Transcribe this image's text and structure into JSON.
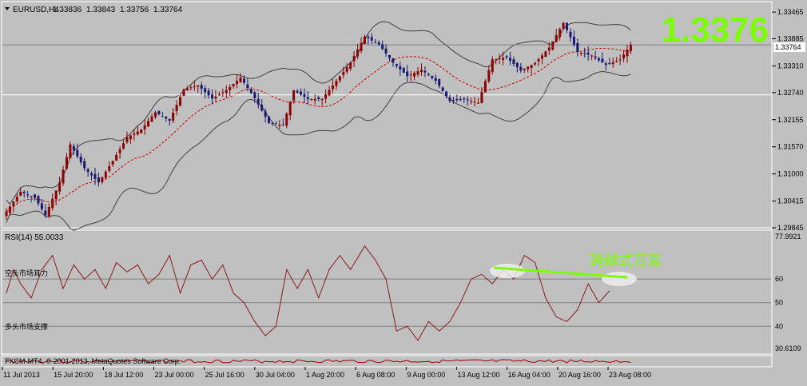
{
  "header": {
    "title": "EURUSD,H4",
    "ohlc": [
      "1.33836",
      "1.33843",
      "1.33756",
      "1.33764"
    ]
  },
  "big_price": "1.3376",
  "current_price_tag": "1.33764",
  "rsi_title": "RSI(14) 55.0033",
  "annotations": {
    "divergence": "跨越式背离",
    "short_zone": "空头市场耳力",
    "long_zone": "多头市场支撑"
  },
  "copyright": "FXCM-MT4, © 2001-2013, MetaQuotes Software Corp.",
  "colors": {
    "background": "#c0c0c0",
    "bull_candle": "#8b0000",
    "bear_candle": "#191970",
    "rsi_line": "#8b1a1a",
    "ma_line": "#d00000",
    "bands": "#404040",
    "big_price": "#7cfc00",
    "divergence": "#7cfc00"
  },
  "chart_data": [
    {
      "type": "candlestick",
      "title": "EURUSD,H4",
      "ylim": [
        1.2985,
        1.3465
      ],
      "ticks": [
        {
          "value": 1.3446,
          "label": "1.33465"
        },
        {
          "value": 1.3389,
          "label": "1.33885"
        },
        {
          "value": 1.3331,
          "label": "1.33310"
        },
        {
          "value": 1.3274,
          "label": "1.32740"
        },
        {
          "value": 1.3216,
          "label": "1.32155"
        },
        {
          "value": 1.3158,
          "label": "1.31570"
        },
        {
          "value": 1.31,
          "label": "1.31000"
        },
        {
          "value": 1.3042,
          "label": "1.30415"
        },
        {
          "value": 1.2985,
          "label": "1.29845"
        }
      ],
      "horizontal_lines": [
        1.3376,
        1.3269
      ],
      "overlays": [
        "Bollinger Bands",
        "Moving Average"
      ],
      "close_anchors": [
        [
          0,
          1.302
        ],
        [
          4,
          1.3062
        ],
        [
          8,
          1.3049
        ],
        [
          11,
          1.3012
        ],
        [
          15,
          1.3082
        ],
        [
          18,
          1.3163
        ],
        [
          22,
          1.3112
        ],
        [
          26,
          1.3082
        ],
        [
          30,
          1.3128
        ],
        [
          34,
          1.3178
        ],
        [
          38,
          1.3195
        ],
        [
          42,
          1.3232
        ],
        [
          46,
          1.3214
        ],
        [
          50,
          1.3281
        ],
        [
          54,
          1.3289
        ],
        [
          58,
          1.3261
        ],
        [
          62,
          1.3279
        ],
        [
          66,
          1.3306
        ],
        [
          70,
          1.3262
        ],
        [
          74,
          1.3209
        ],
        [
          78,
          1.3204
        ],
        [
          81,
          1.3279
        ],
        [
          85,
          1.326
        ],
        [
          89,
          1.326
        ],
        [
          93,
          1.3299
        ],
        [
          97,
          1.3338
        ],
        [
          101,
          1.3394
        ],
        [
          105,
          1.3377
        ],
        [
          109,
          1.3338
        ],
        [
          113,
          1.3309
        ],
        [
          117,
          1.3323
        ],
        [
          121,
          1.3299
        ],
        [
          125,
          1.3256
        ],
        [
          129,
          1.326
        ],
        [
          133,
          1.3252
        ],
        [
          137,
          1.3345
        ],
        [
          141,
          1.3349
        ],
        [
          145,
          1.3321
        ],
        [
          149,
          1.3337
        ],
        [
          153,
          1.337
        ],
        [
          157,
          1.3423
        ],
        [
          161,
          1.3361
        ],
        [
          165,
          1.3353
        ],
        [
          169,
          1.3333
        ],
        [
          173,
          1.3345
        ],
        [
          176,
          1.3376
        ]
      ]
    },
    {
      "type": "line",
      "title": "RSI(14) 55.0033",
      "ylim": [
        30.6109,
        77.9921
      ],
      "ticks": [
        {
          "value": 77.9921,
          "label": "77.9921"
        },
        {
          "value": 60,
          "label": "60"
        },
        {
          "value": 50,
          "label": "50"
        },
        {
          "value": 40,
          "label": "40"
        },
        {
          "value": 30.6109,
          "label": "30.6109"
        }
      ],
      "levels": [
        60,
        50,
        40
      ],
      "series": [
        {
          "anchors": [
            [
              0,
              54
            ],
            [
              2,
              64
            ],
            [
              4,
              58
            ],
            [
              7,
              52
            ],
            [
              10,
              64
            ],
            [
              13,
              70
            ],
            [
              16,
              56
            ],
            [
              19,
              66
            ],
            [
              22,
              60
            ],
            [
              25,
              64
            ],
            [
              28,
              56
            ],
            [
              31,
              67
            ],
            [
              34,
              63
            ],
            [
              37,
              66
            ],
            [
              40,
              58
            ],
            [
              43,
              62
            ],
            [
              46,
              70
            ],
            [
              49,
              54
            ],
            [
              52,
              66
            ],
            [
              55,
              68
            ],
            [
              58,
              60
            ],
            [
              61,
              66
            ],
            [
              64,
              54
            ],
            [
              67,
              50
            ],
            [
              70,
              42
            ],
            [
              73,
              36
            ],
            [
              76,
              40
            ],
            [
              79,
              64
            ],
            [
              82,
              56
            ],
            [
              85,
              64
            ],
            [
              88,
              52
            ],
            [
              91,
              64
            ],
            [
              94,
              70
            ],
            [
              97,
              64
            ],
            [
              101,
              74
            ],
            [
              104,
              68
            ],
            [
              107,
              60
            ],
            [
              110,
              38
            ],
            [
              113,
              40
            ],
            [
              116,
              34
            ],
            [
              119,
              42
            ],
            [
              122,
              38
            ],
            [
              125,
              42
            ],
            [
              128,
              50
            ],
            [
              131,
              60
            ],
            [
              134,
              62
            ],
            [
              137,
              58
            ],
            [
              140,
              64
            ],
            [
              143,
              60
            ],
            [
              146,
              70
            ],
            [
              149,
              67
            ],
            [
              152,
              52
            ],
            [
              155,
              44
            ],
            [
              158,
              42
            ],
            [
              161,
              47
            ],
            [
              164,
              58
            ],
            [
              167,
              50
            ],
            [
              170,
              55
            ]
          ]
        }
      ]
    }
  ],
  "x_axis": [
    "11 Jul 2013",
    "15 Jul 20:00",
    "18 Jul 12:00",
    "23 Jul 00:00",
    "25 Jul 16:00",
    "30 Jul 04:00",
    "1 Aug 20:00",
    "6 Aug 08:00",
    "9 Aug 00:00",
    "13 Aug 12:00",
    "16 Aug 04:00",
    "20 Aug 16:00",
    "23 Aug 08:00"
  ]
}
